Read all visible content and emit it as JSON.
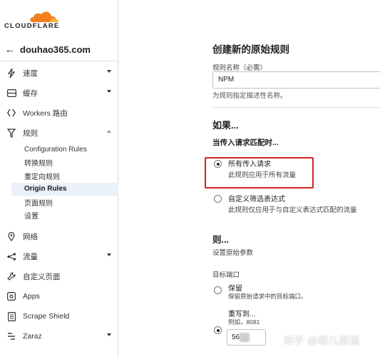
{
  "brand": {
    "name": "CLOUDFLARE",
    "accent": "#f38020"
  },
  "domain": {
    "name": "douhao365.com"
  },
  "nav": {
    "items": [
      {
        "label": "速度",
        "icon": "lightning-icon"
      },
      {
        "label": "缓存",
        "icon": "cache-icon"
      },
      {
        "label": "Workers 路由",
        "icon": "workers-icon"
      },
      {
        "label": "规则",
        "icon": "rules-icon"
      }
    ],
    "rules_sub": [
      "Configuration Rules",
      "转换规则",
      "重定向规则",
      "Origin Rules",
      "页面规则",
      "设置"
    ],
    "more": [
      {
        "label": "网络",
        "icon": "location-pin-icon"
      },
      {
        "label": "流量",
        "icon": "traffic-icon"
      },
      {
        "label": "自定义页面",
        "icon": "wrench-icon"
      },
      {
        "label": "Apps",
        "icon": "apps-icon"
      },
      {
        "label": "Scrape Shield",
        "icon": "document-icon"
      },
      {
        "label": "Zaraz",
        "icon": "zaraz-icon"
      }
    ]
  },
  "form": {
    "title": "创建新的原始规则",
    "rule_name_label": "规则名称（必需）",
    "rule_name_value": "NPM",
    "rule_name_hint": "为规则指定描述性名称。",
    "if_title": "如果...",
    "if_subtitle": "当传入请求匹配时...",
    "options": [
      {
        "title": "所有传入请求",
        "desc": "此规则应用于所有流量",
        "checked": true
      },
      {
        "title": "自定义筛选表达式",
        "desc": "此规则仅应用于与自定义表达式匹配的流量",
        "checked": false
      }
    ],
    "then_title": "则...",
    "then_subtitle": "设置原始参数",
    "port_label": "目标端口",
    "port_options": [
      {
        "title": "保留",
        "desc": "保留原始请求中的目标端口。",
        "checked": false
      },
      {
        "title": "重写到...",
        "desc": "例如，8081",
        "checked": true
      }
    ],
    "port_value": "56"
  },
  "watermark": "知乎 @哪儿都通"
}
